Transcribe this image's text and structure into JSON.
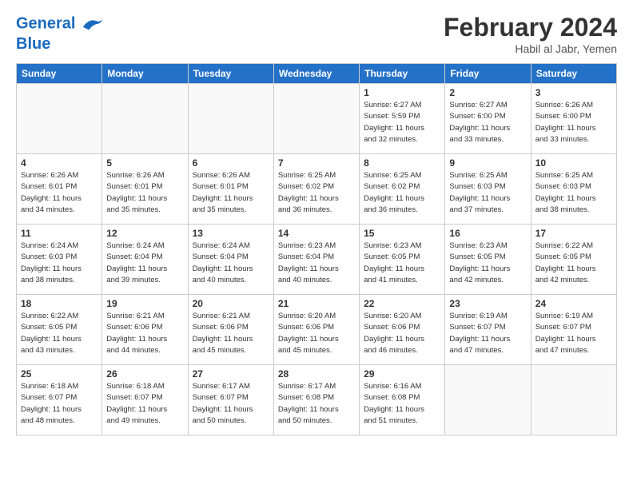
{
  "header": {
    "logo_line1": "General",
    "logo_line2": "Blue",
    "month_title": "February 2024",
    "subtitle": "Habil al Jabr, Yemen"
  },
  "days_of_week": [
    "Sunday",
    "Monday",
    "Tuesday",
    "Wednesday",
    "Thursday",
    "Friday",
    "Saturday"
  ],
  "weeks": [
    [
      {
        "day": "",
        "info": ""
      },
      {
        "day": "",
        "info": ""
      },
      {
        "day": "",
        "info": ""
      },
      {
        "day": "",
        "info": ""
      },
      {
        "day": "1",
        "info": "Sunrise: 6:27 AM\nSunset: 5:59 PM\nDaylight: 11 hours\nand 32 minutes."
      },
      {
        "day": "2",
        "info": "Sunrise: 6:27 AM\nSunset: 6:00 PM\nDaylight: 11 hours\nand 33 minutes."
      },
      {
        "day": "3",
        "info": "Sunrise: 6:26 AM\nSunset: 6:00 PM\nDaylight: 11 hours\nand 33 minutes."
      }
    ],
    [
      {
        "day": "4",
        "info": "Sunrise: 6:26 AM\nSunset: 6:01 PM\nDaylight: 11 hours\nand 34 minutes."
      },
      {
        "day": "5",
        "info": "Sunrise: 6:26 AM\nSunset: 6:01 PM\nDaylight: 11 hours\nand 35 minutes."
      },
      {
        "day": "6",
        "info": "Sunrise: 6:26 AM\nSunset: 6:01 PM\nDaylight: 11 hours\nand 35 minutes."
      },
      {
        "day": "7",
        "info": "Sunrise: 6:25 AM\nSunset: 6:02 PM\nDaylight: 11 hours\nand 36 minutes."
      },
      {
        "day": "8",
        "info": "Sunrise: 6:25 AM\nSunset: 6:02 PM\nDaylight: 11 hours\nand 36 minutes."
      },
      {
        "day": "9",
        "info": "Sunrise: 6:25 AM\nSunset: 6:03 PM\nDaylight: 11 hours\nand 37 minutes."
      },
      {
        "day": "10",
        "info": "Sunrise: 6:25 AM\nSunset: 6:03 PM\nDaylight: 11 hours\nand 38 minutes."
      }
    ],
    [
      {
        "day": "11",
        "info": "Sunrise: 6:24 AM\nSunset: 6:03 PM\nDaylight: 11 hours\nand 38 minutes."
      },
      {
        "day": "12",
        "info": "Sunrise: 6:24 AM\nSunset: 6:04 PM\nDaylight: 11 hours\nand 39 minutes."
      },
      {
        "day": "13",
        "info": "Sunrise: 6:24 AM\nSunset: 6:04 PM\nDaylight: 11 hours\nand 40 minutes."
      },
      {
        "day": "14",
        "info": "Sunrise: 6:23 AM\nSunset: 6:04 PM\nDaylight: 11 hours\nand 40 minutes."
      },
      {
        "day": "15",
        "info": "Sunrise: 6:23 AM\nSunset: 6:05 PM\nDaylight: 11 hours\nand 41 minutes."
      },
      {
        "day": "16",
        "info": "Sunrise: 6:23 AM\nSunset: 6:05 PM\nDaylight: 11 hours\nand 42 minutes."
      },
      {
        "day": "17",
        "info": "Sunrise: 6:22 AM\nSunset: 6:05 PM\nDaylight: 11 hours\nand 42 minutes."
      }
    ],
    [
      {
        "day": "18",
        "info": "Sunrise: 6:22 AM\nSunset: 6:05 PM\nDaylight: 11 hours\nand 43 minutes."
      },
      {
        "day": "19",
        "info": "Sunrise: 6:21 AM\nSunset: 6:06 PM\nDaylight: 11 hours\nand 44 minutes."
      },
      {
        "day": "20",
        "info": "Sunrise: 6:21 AM\nSunset: 6:06 PM\nDaylight: 11 hours\nand 45 minutes."
      },
      {
        "day": "21",
        "info": "Sunrise: 6:20 AM\nSunset: 6:06 PM\nDaylight: 11 hours\nand 45 minutes."
      },
      {
        "day": "22",
        "info": "Sunrise: 6:20 AM\nSunset: 6:06 PM\nDaylight: 11 hours\nand 46 minutes."
      },
      {
        "day": "23",
        "info": "Sunrise: 6:19 AM\nSunset: 6:07 PM\nDaylight: 11 hours\nand 47 minutes."
      },
      {
        "day": "24",
        "info": "Sunrise: 6:19 AM\nSunset: 6:07 PM\nDaylight: 11 hours\nand 47 minutes."
      }
    ],
    [
      {
        "day": "25",
        "info": "Sunrise: 6:18 AM\nSunset: 6:07 PM\nDaylight: 11 hours\nand 48 minutes."
      },
      {
        "day": "26",
        "info": "Sunrise: 6:18 AM\nSunset: 6:07 PM\nDaylight: 11 hours\nand 49 minutes."
      },
      {
        "day": "27",
        "info": "Sunrise: 6:17 AM\nSunset: 6:07 PM\nDaylight: 11 hours\nand 50 minutes."
      },
      {
        "day": "28",
        "info": "Sunrise: 6:17 AM\nSunset: 6:08 PM\nDaylight: 11 hours\nand 50 minutes."
      },
      {
        "day": "29",
        "info": "Sunrise: 6:16 AM\nSunset: 6:08 PM\nDaylight: 11 hours\nand 51 minutes."
      },
      {
        "day": "",
        "info": ""
      },
      {
        "day": "",
        "info": ""
      }
    ]
  ]
}
